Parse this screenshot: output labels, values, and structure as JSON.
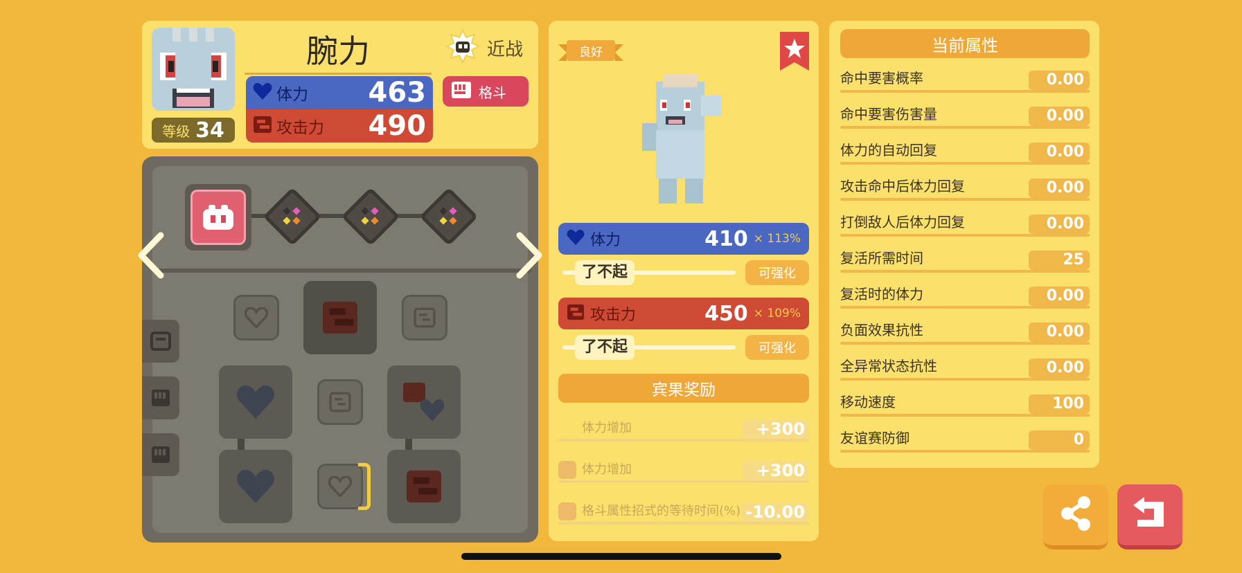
{
  "pokemon": {
    "name": "腕力",
    "level_label": "等级",
    "level": "34",
    "style_label": "近战",
    "type_label": "格斗",
    "hp_label": "体力",
    "hp_value": "463",
    "atk_label": "攻击力",
    "atk_value": "490"
  },
  "detail": {
    "quality_label": "良好",
    "hp": {
      "label": "体力",
      "value": "410",
      "multiplier": "× 113%",
      "grade": "了不起",
      "upgrade_label": "可强化"
    },
    "atk": {
      "label": "攻击力",
      "value": "450",
      "multiplier": "× 109%",
      "grade": "了不起",
      "upgrade_label": "可强化"
    },
    "bingo": {
      "title": "宾果奖励",
      "items": [
        {
          "label": "体力增加",
          "value": "+300"
        },
        {
          "label": "体力增加",
          "value": "+300"
        },
        {
          "label": "格斗属性招式的等待时间(%)",
          "value": "-10.00"
        }
      ]
    }
  },
  "attributes": {
    "title": "当前属性",
    "rows": [
      {
        "label": "命中要害概率",
        "value": "0.00"
      },
      {
        "label": "命中要害伤害量",
        "value": "0.00"
      },
      {
        "label": "体力的自动回复",
        "value": "0.00"
      },
      {
        "label": "攻击命中后体力回复",
        "value": "0.00"
      },
      {
        "label": "打倒敌人后体力回复",
        "value": "0.00"
      },
      {
        "label": "复活所需时间",
        "value": "25"
      },
      {
        "label": "复活时的体力",
        "value": "0.00"
      },
      {
        "label": "负面效果抗性",
        "value": "0.00"
      },
      {
        "label": "全异常状态抗性",
        "value": "0.00"
      },
      {
        "label": "移动速度",
        "value": "100"
      },
      {
        "label": "友谊赛防御",
        "value": "0"
      }
    ]
  },
  "colors": {
    "background": "#f2b83c",
    "panel": "#fbe06b",
    "hp_blue": "#4a67c2",
    "atk_red": "#cf4a35",
    "type_fighting": "#d9475c",
    "accent_orange": "#efa838"
  },
  "icons": [
    "heart-icon",
    "attack-icon",
    "fist-icon",
    "melee-icon",
    "star-icon",
    "share-icon",
    "back-icon",
    "chevron-left-icon",
    "chevron-right-icon"
  ]
}
